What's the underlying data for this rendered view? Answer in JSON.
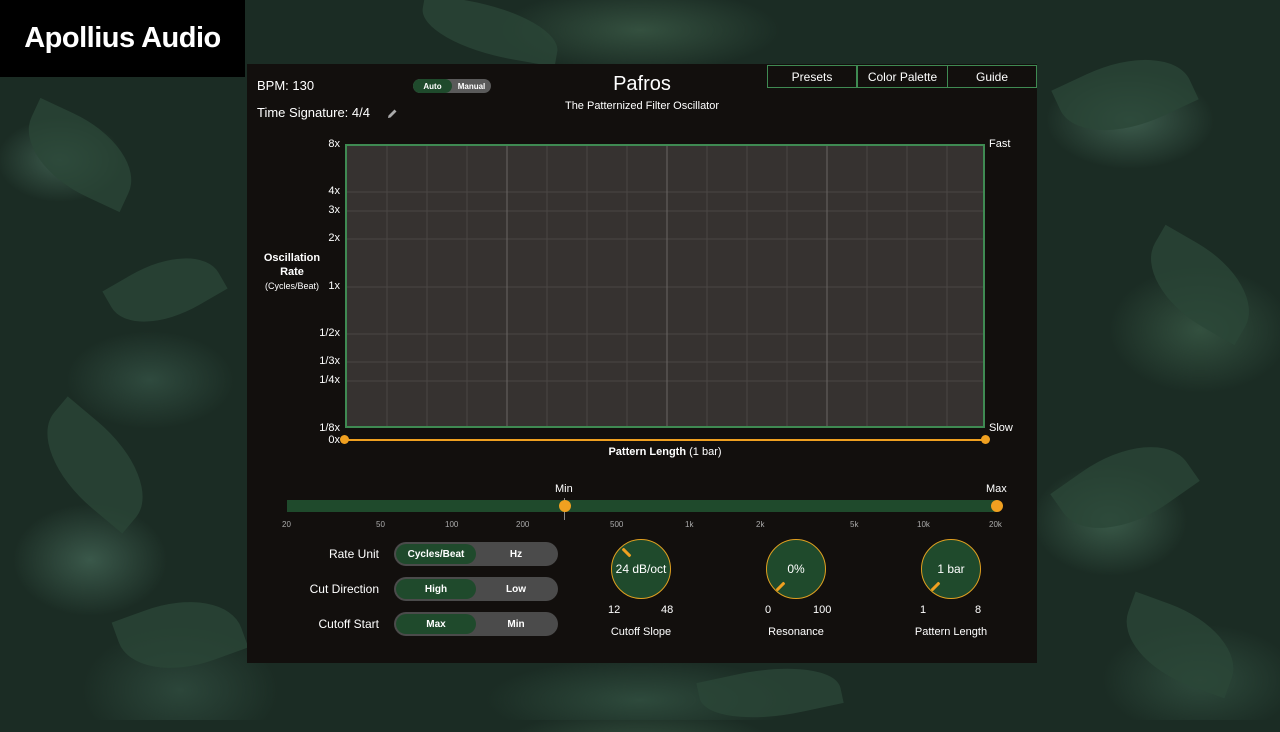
{
  "brand": {
    "name": "Apollius Audio"
  },
  "header": {
    "bpm_label": "BPM: 130",
    "time_signature_label": "Time Signature: 4/4",
    "mode_toggle": {
      "options": [
        "Auto",
        "Manual"
      ],
      "selected": "Auto"
    },
    "title": "Pafros",
    "subtitle": "The Patternized Filter Oscillator",
    "buttons": [
      "Presets",
      "Color Palette",
      "Guide"
    ]
  },
  "plot": {
    "y_title": "Oscillation",
    "y_title2": "Rate",
    "y_unit": "(Cycles/Beat)",
    "y_ticks": [
      "8x",
      "4x",
      "3x",
      "2x",
      "1x",
      "1/2x",
      "1/3x",
      "1/4x",
      "1/8x",
      "0x"
    ],
    "right_top": "Fast",
    "right_bottom": "Slow",
    "x_title": "Pattern Length",
    "x_title_suffix": "(1 bar)"
  },
  "freq_slider": {
    "min_label": "Min",
    "max_label": "Max",
    "ticks": [
      "20",
      "50",
      "100",
      "200",
      "500",
      "1k",
      "2k",
      "5k",
      "10k",
      "20k"
    ],
    "min_value_hz": 300,
    "max_value_hz": 20000
  },
  "controls": {
    "rate_unit": {
      "label": "Rate Unit",
      "options": [
        "Cycles/Beat",
        "Hz"
      ],
      "selected": "Cycles/Beat"
    },
    "cut_direction": {
      "label": "Cut Direction",
      "options": [
        "High",
        "Low"
      ],
      "selected": "High"
    },
    "cutoff_start": {
      "label": "Cutoff Start",
      "options": [
        "Max",
        "Min"
      ],
      "selected": "Max"
    }
  },
  "knobs": {
    "cutoff_slope": {
      "value": "24 dB/oct",
      "min": "12",
      "max": "48",
      "label": "Cutoff Slope"
    },
    "resonance": {
      "value": "0%",
      "min": "0",
      "max": "100",
      "label": "Resonance"
    },
    "pattern_length": {
      "value": "1 bar",
      "min": "1",
      "max": "8",
      "label": "Pattern Length"
    }
  },
  "colors": {
    "accent": "#f0a020",
    "green": "#1f4a2c",
    "border_green": "#3f8a52",
    "panel": "#120f0d",
    "plot_bg": "#363230"
  },
  "icons": [
    "pencil-icon"
  ]
}
